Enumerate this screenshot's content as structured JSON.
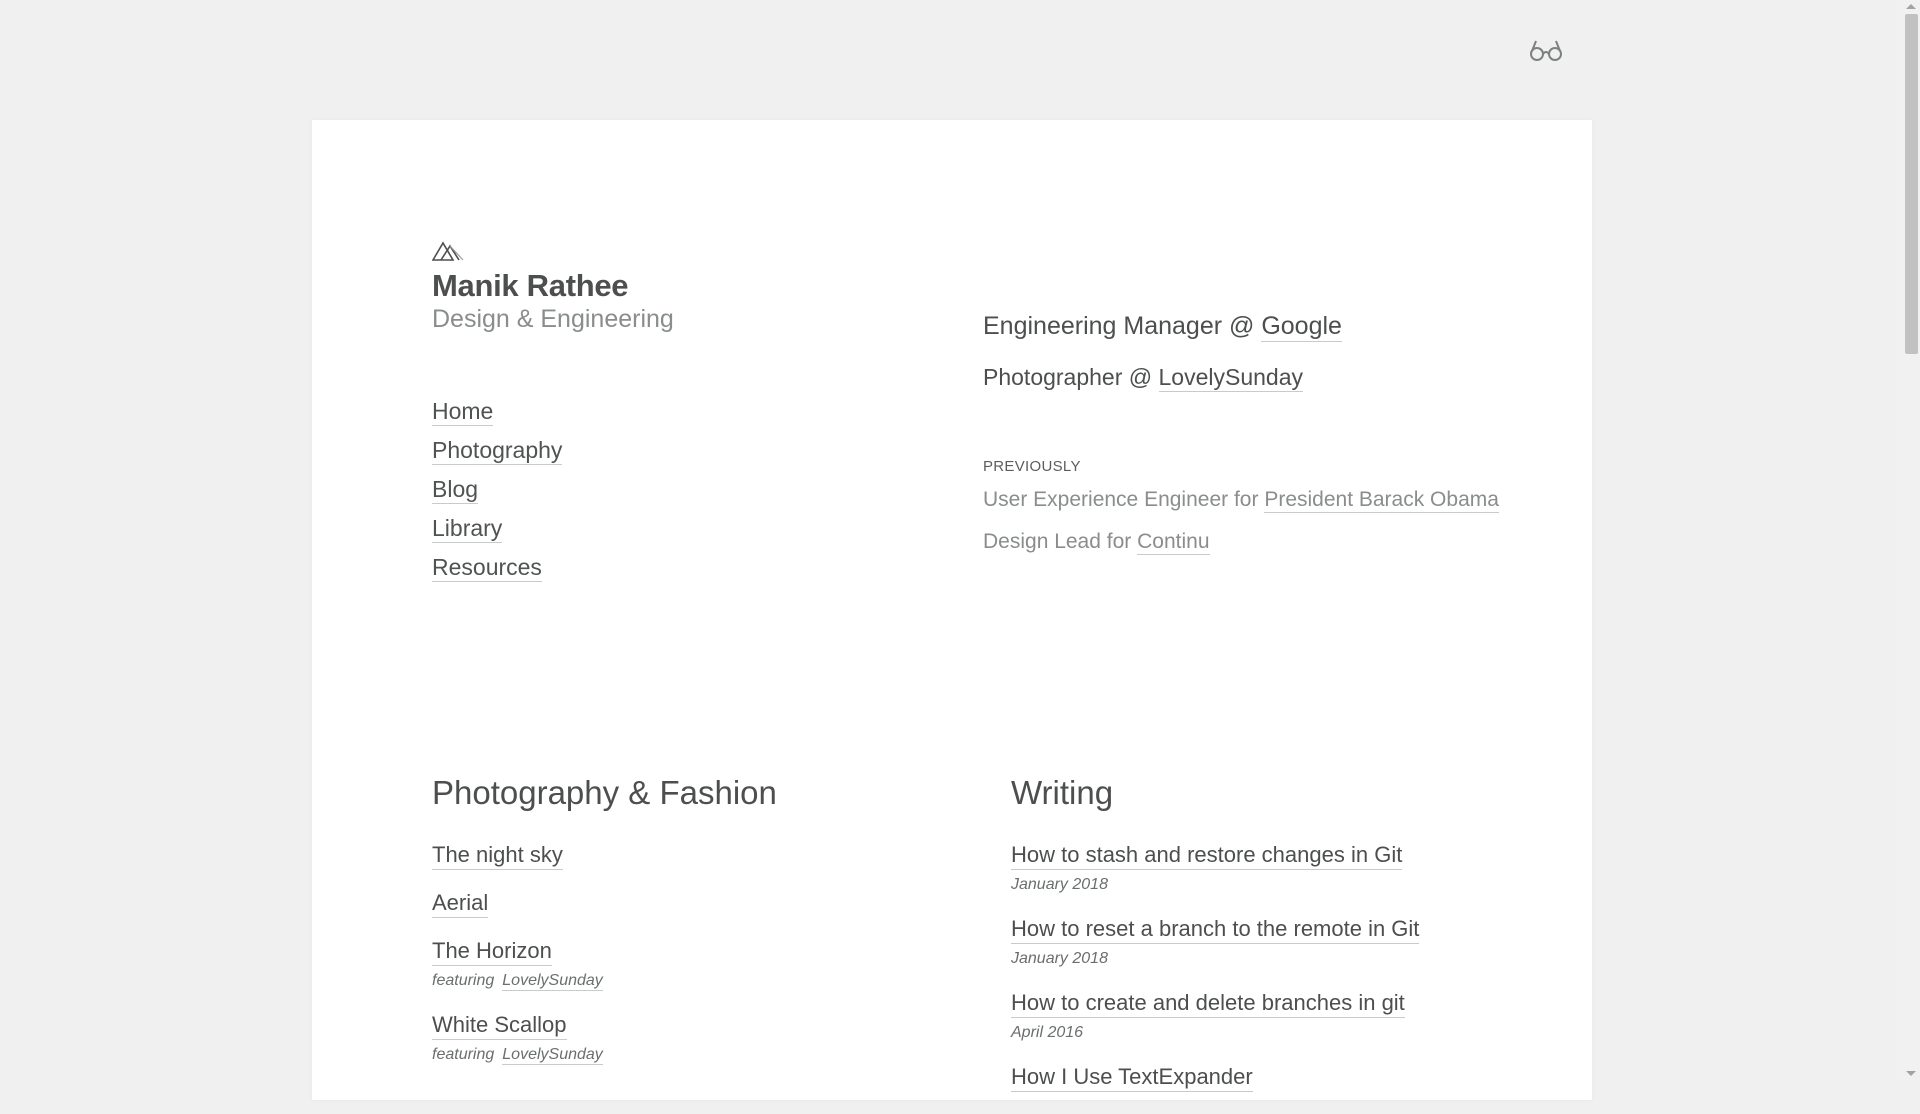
{
  "header": {
    "reader_icon": "glasses-icon"
  },
  "site": {
    "logo_icon": "mountain-logo-icon",
    "name": "Manik Rathee",
    "tagline": "Design & Engineering"
  },
  "nav": {
    "items": [
      {
        "label": "Home"
      },
      {
        "label": "Photography"
      },
      {
        "label": "Blog"
      },
      {
        "label": "Library"
      },
      {
        "label": "Resources"
      }
    ]
  },
  "roles": {
    "current": [
      {
        "prefix": "Engineering Manager @ ",
        "link": "Google"
      },
      {
        "prefix": "Photographer @ ",
        "link": "LovelySunday"
      }
    ],
    "previously_label": "PREVIOUSLY",
    "previous": [
      {
        "prefix": "User Experience Engineer for ",
        "link": "President Barack Obama"
      },
      {
        "prefix": "Design Lead for ",
        "link": "Continu"
      }
    ]
  },
  "photography": {
    "title": "Photography & Fashion",
    "items": [
      {
        "title": "The night sky"
      },
      {
        "title": "Aerial"
      },
      {
        "title": "The Horizon",
        "featuring_label": "featuring",
        "featuring": "LovelySunday"
      },
      {
        "title": "White Scallop",
        "featuring_label": "featuring",
        "featuring": "LovelySunday"
      }
    ]
  },
  "writing": {
    "title": "Writing",
    "items": [
      {
        "title": "How to stash and restore changes in Git",
        "date": "January 2018"
      },
      {
        "title": "How to reset a branch to the remote in Git",
        "date": "January 2018"
      },
      {
        "title": "How to create and delete branches in git",
        "date": "April 2016"
      },
      {
        "title": "How I Use TextExpander",
        "date": ""
      }
    ]
  },
  "colors": {
    "page_background": "#eff0ef",
    "card_background": "#ffffff",
    "text": "#4d4f4f",
    "muted_text": "#8a8d8d",
    "link_underline": "#c9cbcb"
  }
}
